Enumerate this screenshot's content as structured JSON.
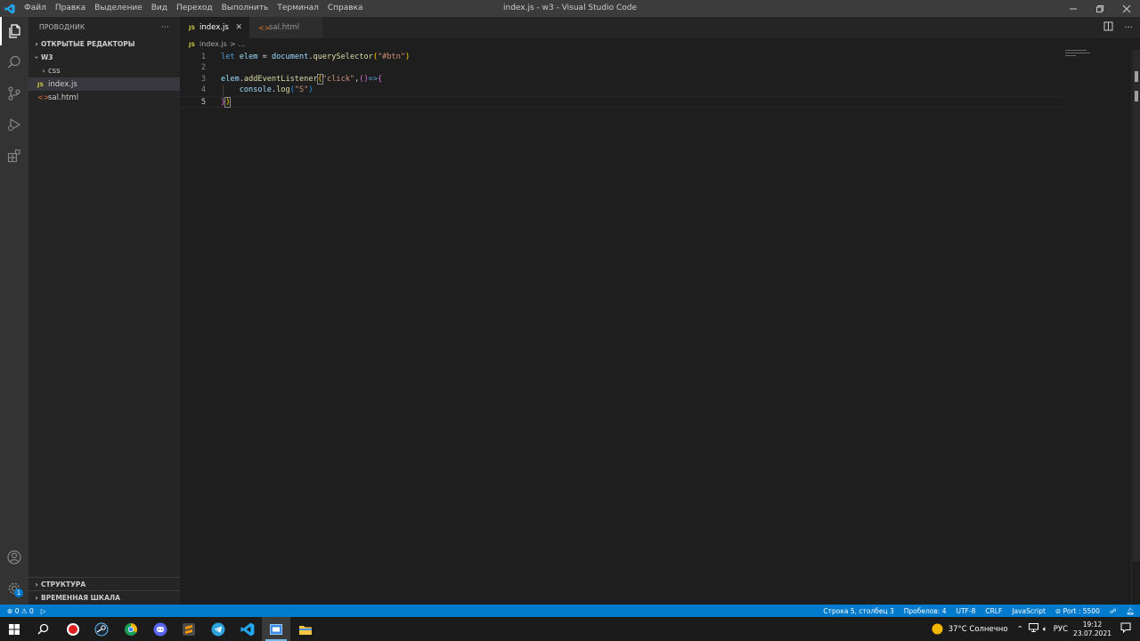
{
  "titlebar": {
    "menu": [
      "Файл",
      "Правка",
      "Выделение",
      "Вид",
      "Переход",
      "Выполнить",
      "Терминал",
      "Справка"
    ],
    "title": "index.js - w3 - Visual Studio Code"
  },
  "sidebar": {
    "header": "ПРОВОДНИК",
    "more": "···",
    "open_editors": "ОТКРЫТЫЕ РЕДАКТОРЫ",
    "folder": "W3",
    "items": [
      {
        "label": "css"
      },
      {
        "label": "index.js",
        "icon": "JS"
      },
      {
        "label": "sal.html",
        "icon": "<>"
      }
    ],
    "structure": "СТРУКТУРА",
    "timeline": "ВРЕМЕННАЯ ШКАЛА"
  },
  "tabs": [
    {
      "label": "index.js",
      "icon": "JS"
    },
    {
      "label": "sal.html",
      "icon": "<>"
    }
  ],
  "breadcrumb": {
    "file": "index.js",
    "sep": ">",
    "rest": "..."
  },
  "editor": {
    "line_numbers": [
      "1",
      "2",
      "3",
      "4",
      "5"
    ],
    "lines": {
      "l1": {
        "kw": "let",
        "var1": "elem",
        "eq": " = ",
        "var2": "document",
        "dot": ".",
        "fn": "querySelector",
        "open": "(",
        "str": "\"#btn\"",
        "close": ")"
      },
      "l3": {
        "var": "elem",
        "dot": ".",
        "fn": "addEventListener",
        "open": "(",
        "str": "\"click\"",
        "comma": ",",
        "parens": "()",
        "arrow": "=>",
        "brace": "{"
      },
      "l4": {
        "indent": "    ",
        "var": "console",
        "dot": ".",
        "fn": "log",
        "open": "(",
        "str": "\"S\"",
        "close": ")"
      },
      "l5": {
        "brace": "}",
        "close": ")"
      }
    }
  },
  "statusbar": {
    "errors": "0",
    "warnings": "0",
    "position": "Строка 5, столбец 3",
    "spaces": "Пробелов: 4",
    "encoding": "UTF-8",
    "eol": "CRLF",
    "language": "JavaScript",
    "port": "Port : 5500"
  },
  "taskbar": {
    "weather": "37°C  Солнечно",
    "lang": "РУС",
    "time": "19:12",
    "date": "23.07.2021"
  },
  "accounts_badge": "1",
  "colors": {
    "accent": "#007acc",
    "titlebar": "#3c3c3c",
    "activitybar": "#333333",
    "sidebar": "#252526",
    "editor": "#1e1e1e"
  }
}
